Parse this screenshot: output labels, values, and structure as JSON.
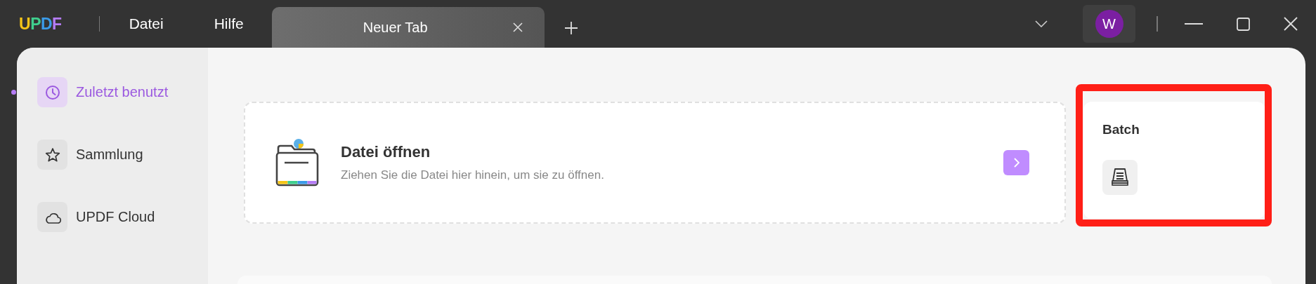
{
  "titlebar": {
    "logo": "UPDF",
    "menu": [
      "Datei",
      "Hilfe"
    ],
    "tabs": [
      {
        "label": "Neuer Tab",
        "selected": true
      }
    ],
    "avatar": "W"
  },
  "sidebar": {
    "items": [
      {
        "label": "Zuletzt benutzt",
        "selected": true
      },
      {
        "label": "Sammlung",
        "selected": false
      },
      {
        "label": "UPDF Cloud",
        "selected": false
      }
    ]
  },
  "open_card": {
    "title": "Datei öffnen",
    "subtitle": "Ziehen Sie die Datei hier hinein, um sie zu öffnen."
  },
  "batch_card": {
    "title": "Batch",
    "highlighted": true
  }
}
